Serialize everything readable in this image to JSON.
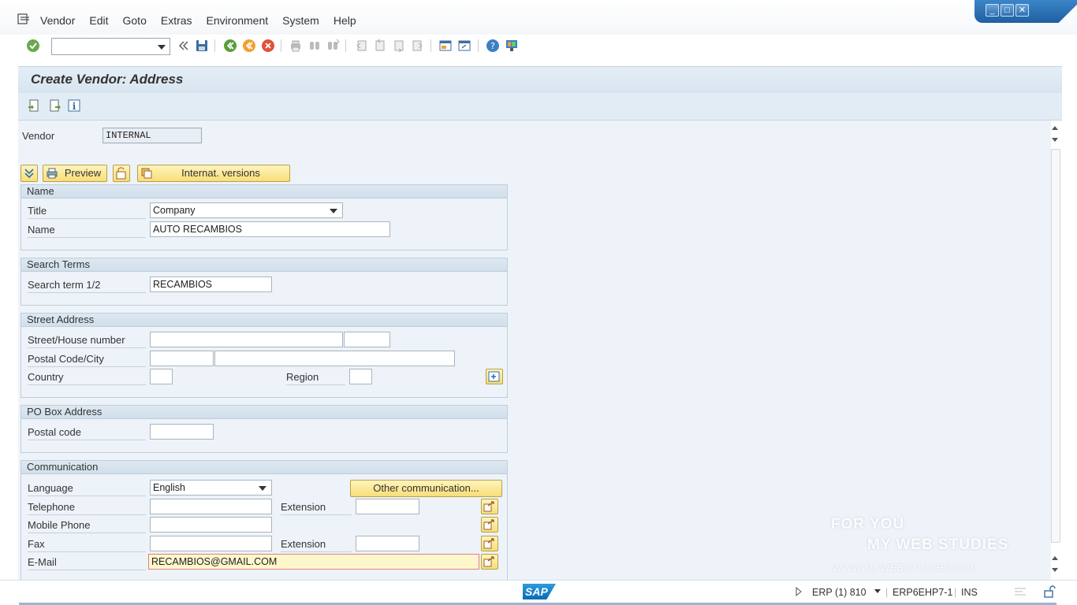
{
  "menubar": {
    "items": [
      {
        "label": "Vendor"
      },
      {
        "label": "Edit"
      },
      {
        "label": "Goto"
      },
      {
        "label": "Extras"
      },
      {
        "label": "Environment"
      },
      {
        "label": "System"
      },
      {
        "label": "Help"
      }
    ]
  },
  "window_controls": {
    "minimize": "_",
    "maximize": "□",
    "close": "✕"
  },
  "toolbar": {
    "command_field_value": "",
    "icons": [
      "enter-icon",
      "back-double-icon",
      "save-icon",
      "back-icon",
      "exit-icon",
      "cancel-icon",
      "print-icon",
      "find-icon",
      "find-next-icon",
      "first-page-icon",
      "previous-page-icon",
      "next-page-icon",
      "last-page-icon",
      "new-session-icon",
      "shortcut-icon",
      "help-icon",
      "customize-layout-icon"
    ]
  },
  "title": "Create Vendor: Address",
  "vendor": {
    "label": "Vendor",
    "value": "INTERNAL"
  },
  "address_buttons": {
    "preview": "Preview",
    "internat_versions": "Internat. versions"
  },
  "name_group": {
    "header": "Name",
    "title_label": "Title",
    "title_value": "Company",
    "name_label": "Name",
    "name_value": "AUTO RECAMBIOS"
  },
  "search_group": {
    "header": "Search Terms",
    "label": "Search term 1/2",
    "value": "RECAMBIOS"
  },
  "street_group": {
    "header": "Street Address",
    "street_label": "Street/House number",
    "street_value": "",
    "house_value": "",
    "postal_label": "Postal Code/City",
    "postal_value": "",
    "city_value": "",
    "country_label": "Country",
    "country_value": "",
    "region_label": "Region",
    "region_value": ""
  },
  "pobox_group": {
    "header": "PO Box Address",
    "postal_label": "Postal code",
    "postal_value": ""
  },
  "comm_group": {
    "header": "Communication",
    "language_label": "Language",
    "language_value": "English",
    "other_comm_button": "Other communication...",
    "telephone_label": "Telephone",
    "telephone_value": "",
    "extension_label": "Extension",
    "telephone_ext_value": "",
    "mobile_label": "Mobile Phone",
    "mobile_value": "",
    "fax_label": "Fax",
    "fax_value": "",
    "fax_extension_label": "Extension",
    "fax_ext_value": "",
    "email_label": "E-Mail",
    "email_value": "RECAMBIOS@GMAIL.COM"
  },
  "statusbar": {
    "system": "ERP (1) 810",
    "server": "ERP6EHP7-1",
    "mode": "INS",
    "logo": "SAP"
  },
  "watermark": {
    "line1": "FOR YOU",
    "line2": "MY WEB STUDIES",
    "line3": "WWW.MYWEBSTUDIES.COM"
  },
  "colors": {
    "accent": "#0b6bb5",
    "button_yellow": "#f8de78",
    "panel": "#edf3f8"
  }
}
